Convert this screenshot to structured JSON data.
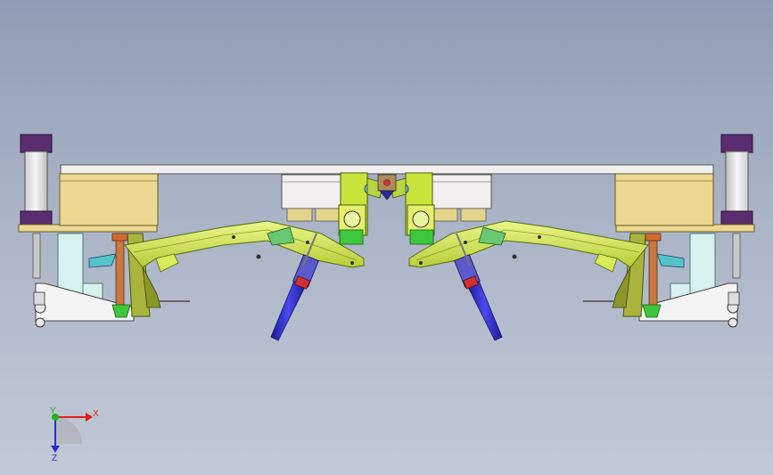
{
  "viewport": {
    "name": "cad-graphics-area",
    "background_top": "#8f9cb3",
    "background_bottom": "#c2c9d6"
  },
  "model": {
    "description_icon": "welding-fixture-assembly",
    "colors": {
      "beam": "#f1eff0",
      "block": "#ecd892",
      "cylinder_cap": "#5a2d6e",
      "cylinder_body": "#e4e4e4",
      "arm": "#d8ec5a",
      "arm_dark": "#9cab2c",
      "gun": "#2a2ac8",
      "clamp": "#55c4c8",
      "green": "#3cc83c",
      "red": "#d03030",
      "copper": "#c87840"
    }
  },
  "triad": {
    "x_label": "X",
    "y_label": "Y",
    "z_label": "Z",
    "x_color": "#e02020",
    "y_color": "#20b020",
    "z_color": "#2030d0"
  }
}
